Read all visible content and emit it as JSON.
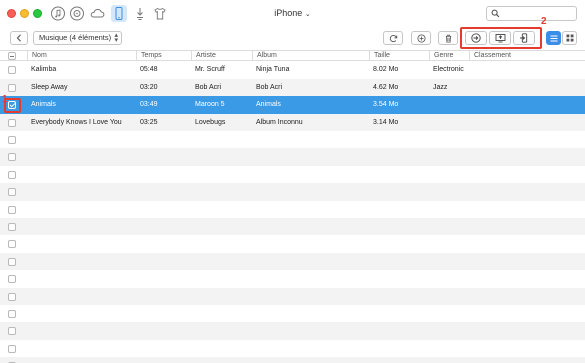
{
  "window": {
    "device_name": "iPhone",
    "device_chevron": "⌄"
  },
  "toolbar_icons": [
    "music-note-icon",
    "itunes-library-icon",
    "icloud-icon",
    "iphone-icon",
    "download-icon",
    "tshirt-icon"
  ],
  "search": {
    "placeholder": ""
  },
  "category": {
    "label": "Musique (4 éléments)",
    "updown": "⌃⌄"
  },
  "callouts": {
    "first": "1",
    "second": "2"
  },
  "colors": {
    "accent": "#3b9ae6",
    "callout": "#e53a2e",
    "row_stripe": "#f3f3f3"
  },
  "table": {
    "columns": [
      "Nom",
      "Temps",
      "Artiste",
      "Album",
      "Taille",
      "Genre",
      "Classement"
    ],
    "rows": [
      {
        "checked": false,
        "selected": false,
        "name": "Kalimba",
        "time": "05:48",
        "artist": "Mr. Scruff",
        "album": "Ninja Tuna",
        "size": "8.02 Mo",
        "genre": "Electronic",
        "rating": ""
      },
      {
        "checked": false,
        "selected": false,
        "name": "Sleep Away",
        "time": "03:20",
        "artist": "Bob Acri",
        "album": "Bob Acri",
        "size": "4.62 Mo",
        "genre": "Jazz",
        "rating": ""
      },
      {
        "checked": true,
        "selected": true,
        "name": "Animals",
        "time": "03:49",
        "artist": "Maroon 5",
        "album": "Animals",
        "size": "3.54 Mo",
        "genre": "",
        "rating": ""
      },
      {
        "checked": false,
        "selected": false,
        "name": "Everybody Knows I Love You",
        "time": "03:25",
        "artist": "Lovebugs",
        "album": "Album Inconnu",
        "size": "3.14 Mo",
        "genre": "",
        "rating": ""
      }
    ]
  }
}
